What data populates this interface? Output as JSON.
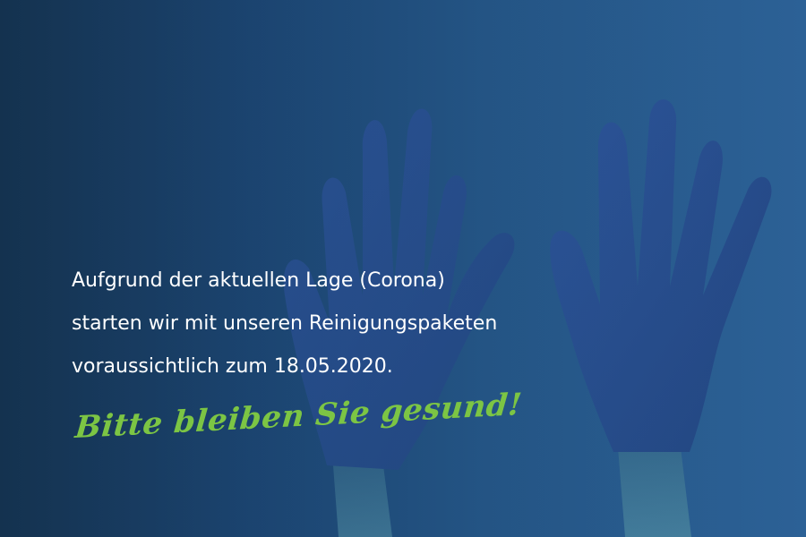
{
  "colors": {
    "background_dark": "#14324f",
    "background_light": "#2c6196",
    "glove_blue": "#2a4f92",
    "text_white": "#ffffff",
    "slogan_green": "#7cc544"
  },
  "notice": {
    "line1": "Aufgrund der aktuellen Lage (Corona)",
    "line2": "starten wir mit unseren Reinigungspaketen",
    "line3": "voraussichtlich zum 18.05.2020."
  },
  "slogan": "Bitte bleiben Sie gesund!",
  "image": {
    "subject_icon": "gloved-hands-raised"
  }
}
